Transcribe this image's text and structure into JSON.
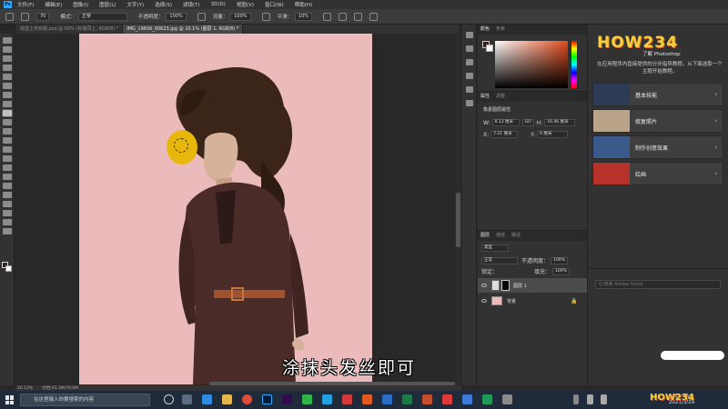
{
  "menubar": {
    "logo": "Ps",
    "items": [
      "文件(F)",
      "编辑(E)",
      "图像(I)",
      "图层(L)",
      "文字(Y)",
      "选择(S)",
      "滤镜(T)",
      "3D(D)",
      "视图(V)",
      "窗口(W)",
      "帮助(H)"
    ]
  },
  "options": {
    "brush_size": "70",
    "mode_label": "模式：",
    "mode_value": "正常",
    "opacity_label": "不透明度：",
    "opacity_value": "100%",
    "flow_label": "流量：",
    "flow_value": "100%",
    "smooth_label": "平滑：",
    "smooth_value": "10%"
  },
  "tabs": [
    {
      "label": "综选上传标题.psd @ 50% (标题同上, RGB/8) *"
    },
    {
      "label": "IMG_19656_00623.jpg @ 20.1% (图层 1, RGB/8) *"
    }
  ],
  "canvas": {
    "subtitle": "涂抹头发丝即可",
    "artboard_color": "#ebbaba",
    "brush_color": "#e8b70c"
  },
  "status": {
    "zoom": "20.13%",
    "doc_info": "文档:63.3M/79.0M"
  },
  "color_panel": {
    "tabs": [
      "颜色",
      "色板"
    ],
    "foreground": "#3a1e17",
    "background": "#ffffff"
  },
  "properties": {
    "tabs": [
      "属性",
      "调整"
    ],
    "heading": "像素图层属性",
    "w_label": "W:",
    "w_value": "8.13 厘米",
    "link_label": "GO",
    "h_label": "H:",
    "h_value": "16.46 厘米",
    "x_label": "X:",
    "x_value": "7.21 厘米",
    "y_label": "Y:",
    "y_value": "0 厘米"
  },
  "layers": {
    "tabs": [
      "图层",
      "通道",
      "路径"
    ],
    "kind_filter": "类型",
    "blend_mode": "正常",
    "opacity_label": "不透明度：",
    "opacity_value": "100%",
    "lock_label": "锁定：",
    "fill_label": "填充：",
    "fill_value": "100%",
    "items": [
      {
        "name": "图层 1"
      },
      {
        "name": "背景"
      }
    ]
  },
  "learn": {
    "logo": "HOW234",
    "subtitle": "了解 Photoshop",
    "description": "在应用程序内直接提供的分步指导教程。从下面选取一个主题开始教程。",
    "cards": [
      {
        "title": "基本技能",
        "color": "#2d3b57"
      },
      {
        "title": "修复照片",
        "color": "#b9a48a"
      },
      {
        "title": "制作创意效果",
        "color": "#3a5a8c"
      },
      {
        "title": "绘画",
        "color": "#b8322c"
      }
    ]
  },
  "lower_right": {
    "search_placeholder": "Q 搜索 Adobe Stock"
  },
  "taskbar": {
    "search_placeholder": "在这里输入你要搜索的内容",
    "time": "11:03",
    "date": "2021/3/29"
  },
  "watermark": "HOW234"
}
